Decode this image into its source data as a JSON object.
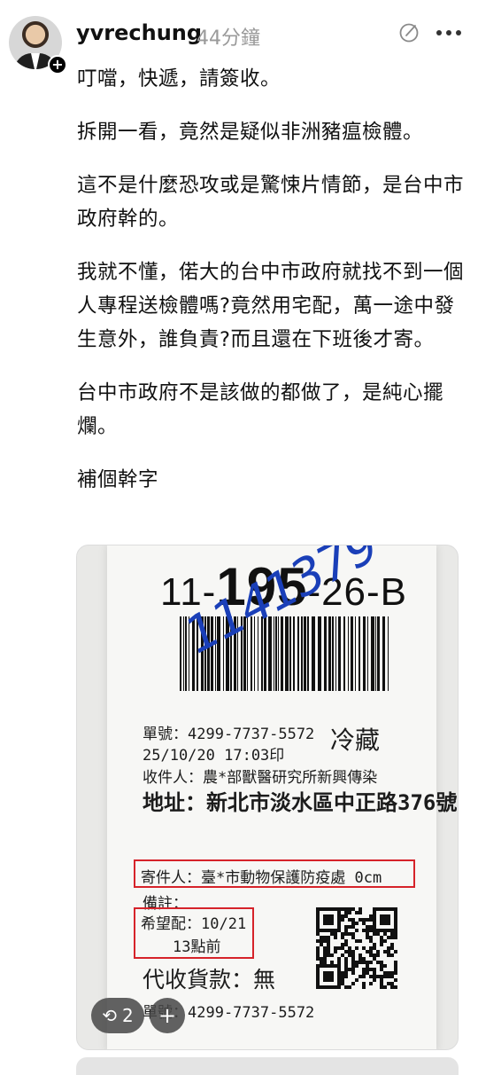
{
  "header": {
    "username": "yvrechung",
    "timestamp": "44分鐘",
    "follow_symbol": "+",
    "edit_icon": "edit-circle-icon",
    "more_icon": "more-horizontal-icon"
  },
  "post": {
    "paragraphs": [
      "叮噹，快遞，請簽收。",
      "拆開一看，竟然是疑似非洲豬瘟檢體。",
      "這不是什麼恐攻或是驚悚片情節，是台中市政府幹的。",
      "我就不懂，偌大的台中市政府就找不到一個人專程送檢體嗎?竟然用宅配，萬一途中發生意外，誰負責?而且還在下班後才寄。",
      "台中市政府不是該做的都做了，是純心擺爛。",
      "補個幹字"
    ]
  },
  "photo": {
    "sort_code_prefix": "11-",
    "sort_code_main": "195",
    "sort_code_suffix": "-26-B",
    "handwritten_number": "1141379",
    "order_line": "單號：4299-7737-5572",
    "date_line": "25/10/20 17:03印",
    "cold_label": "冷藏",
    "recipient_line": "收件人：農*部獸醫研究所新興傳染",
    "address_line": "地址：新北市淡水區中正路376號",
    "sender_line": "寄件人：臺*市動物保護防疫處 0cm",
    "note_line": "備註：",
    "delivery_line": "希望配：10/21",
    "delivery_time": "13點前",
    "cod_line": "代收貨款：無",
    "order_line_bottom": "單號：4299-7737-5572",
    "highlight_color": "#d6232a",
    "ink_color": "#1a3fb8"
  },
  "actions": {
    "repost_icon": "repost-icon",
    "repost_count": "2",
    "add_symbol": "+"
  }
}
